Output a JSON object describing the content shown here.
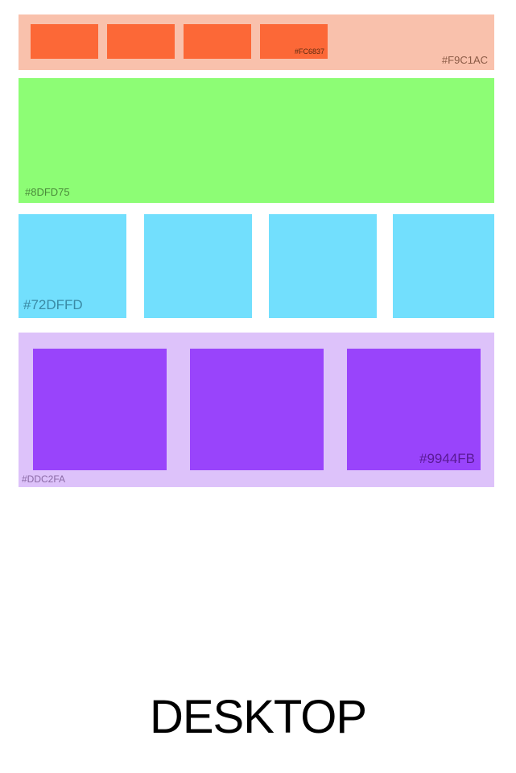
{
  "colors": {
    "header_band": "#F9C1AC",
    "nav_box": "#FC6837",
    "hero_band": "#8DFD75",
    "feature_box": "#72DFFD",
    "card_band": "#DDC2FA",
    "card": "#9944FB"
  },
  "header_band": {
    "label": "#F9C1AC",
    "nav_boxes": [
      {
        "label": ""
      },
      {
        "label": ""
      },
      {
        "label": ""
      },
      {
        "label": "#FC6837"
      }
    ]
  },
  "hero_band": {
    "label": "#8DFD75"
  },
  "feature_row": {
    "label": "#72DFFD"
  },
  "card_band": {
    "label": "#DDC2FA",
    "cards": [
      {
        "label": ""
      },
      {
        "label": ""
      },
      {
        "label": "#9944FB"
      }
    ]
  },
  "title": "DESKTOP"
}
